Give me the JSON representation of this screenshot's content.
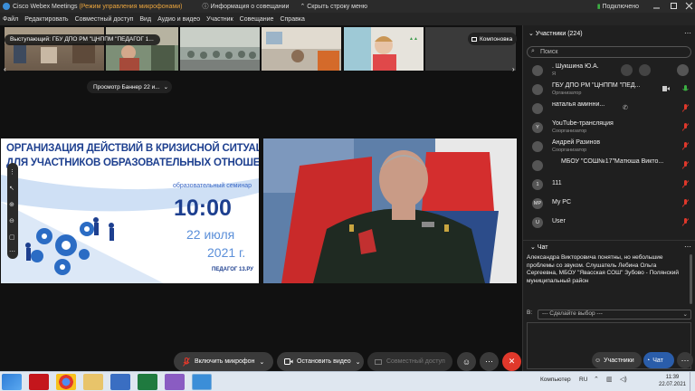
{
  "titlebar": {
    "app": "Cisco Webex Meetings",
    "mode": "(Режим управления микрофонами)",
    "meeting_info": "Информация о совещании",
    "hide_bar": "Скрыть строку меню",
    "status": "Подключено"
  },
  "menu": [
    "Файл",
    "Редактировать",
    "Совместный доступ",
    "Вид",
    "Аудио и видео",
    "Участник",
    "Совещание",
    "Справка"
  ],
  "stage": {
    "speaker_label": "Выступающий: ГБУ ДПО РМ \"ЦНППМ \"ПЕДАГОГ 1...",
    "layout_button": "Компоновка",
    "banner_view": "Просмотр Баннер 22 и..."
  },
  "banner": {
    "title_line1": "ОРГАНИЗАЦИЯ ДЕЙСТВИЙ В КРИЗИСНОЙ СИТУАЦИИ",
    "title_line2": "ДЛЯ УЧАСТНИКОВ ОБРАЗОВАТЕЛЬНЫХ ОТНОШЕНИЙ",
    "subtitle": "образовательный семинар",
    "time": "10:00",
    "date_line1": "22 июля",
    "date_line2": "2021 г.",
    "org": "ПЕДАГОГ 13.РУ"
  },
  "controls": {
    "mic": "Включить микрофон",
    "video": "Остановить видео",
    "share": "Совместный доступ"
  },
  "participants": {
    "header": "Участники (224)",
    "search_placeholder": "Поиск",
    "list": [
      {
        "avatar": "",
        "name": ". Шукшина Ю.А.",
        "role": "Я"
      },
      {
        "avatar": "",
        "name": "ГБУ ДПО РМ \"ЦНППМ \"ПЕД...",
        "role": "Организатор"
      },
      {
        "avatar": "",
        "name": "наталья аминни...",
        "role": ""
      },
      {
        "avatar": "Y",
        "name": "YouTube-трансляция",
        "role": "Соорганизатор"
      },
      {
        "avatar": "",
        "name": "Андрей Разинов",
        "role": "Соорганизатор"
      },
      {
        "avatar": "",
        "name": "МБОУ \"СОШ№17\"Матюша Викто...",
        "role": ""
      },
      {
        "avatar": "1",
        "name": "111",
        "role": ""
      },
      {
        "avatar": "MP",
        "name": "My PC",
        "role": ""
      },
      {
        "avatar": "U",
        "name": "User",
        "role": ""
      }
    ],
    "button": "Участники"
  },
  "chat": {
    "header": "Чат",
    "message": "Александра Викторовича понятны, но небольшие проблемы со звуком. Слушатель Лебина Ольга Сергеевна, МБОУ \"Явасская СОШ\" Зубово - Полянский муниципальный район",
    "to_label": "В:",
    "to_select": "--- Сделайте выбор ---",
    "button": "Чат"
  },
  "taskbar": {
    "tray_text": "Компьютер",
    "lang": "RU",
    "time": "11:39",
    "date": "22.07.2021"
  },
  "colors": {
    "accent": "#2a5daa",
    "leave": "#e0382b",
    "banner_title": "#1d3f8f",
    "mic_muted": "#e0382b",
    "mic_on": "#3cb043"
  }
}
